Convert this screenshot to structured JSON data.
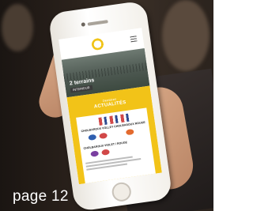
{
  "caption": "page 12",
  "hero": {
    "title": "2 terrains",
    "badge": "INTERIEUR"
  },
  "news": {
    "subtitle": "Dernières",
    "title": "ACTUALITÉS",
    "card_heading": "CHOLBAROUX VOLLEY CHOLBAROUX ROUGE",
    "card_heading_2": "CHOLBAROUX VIOLET / ROUGE"
  },
  "colors": {
    "accent": "#f2c318",
    "background": "#2a211b"
  }
}
